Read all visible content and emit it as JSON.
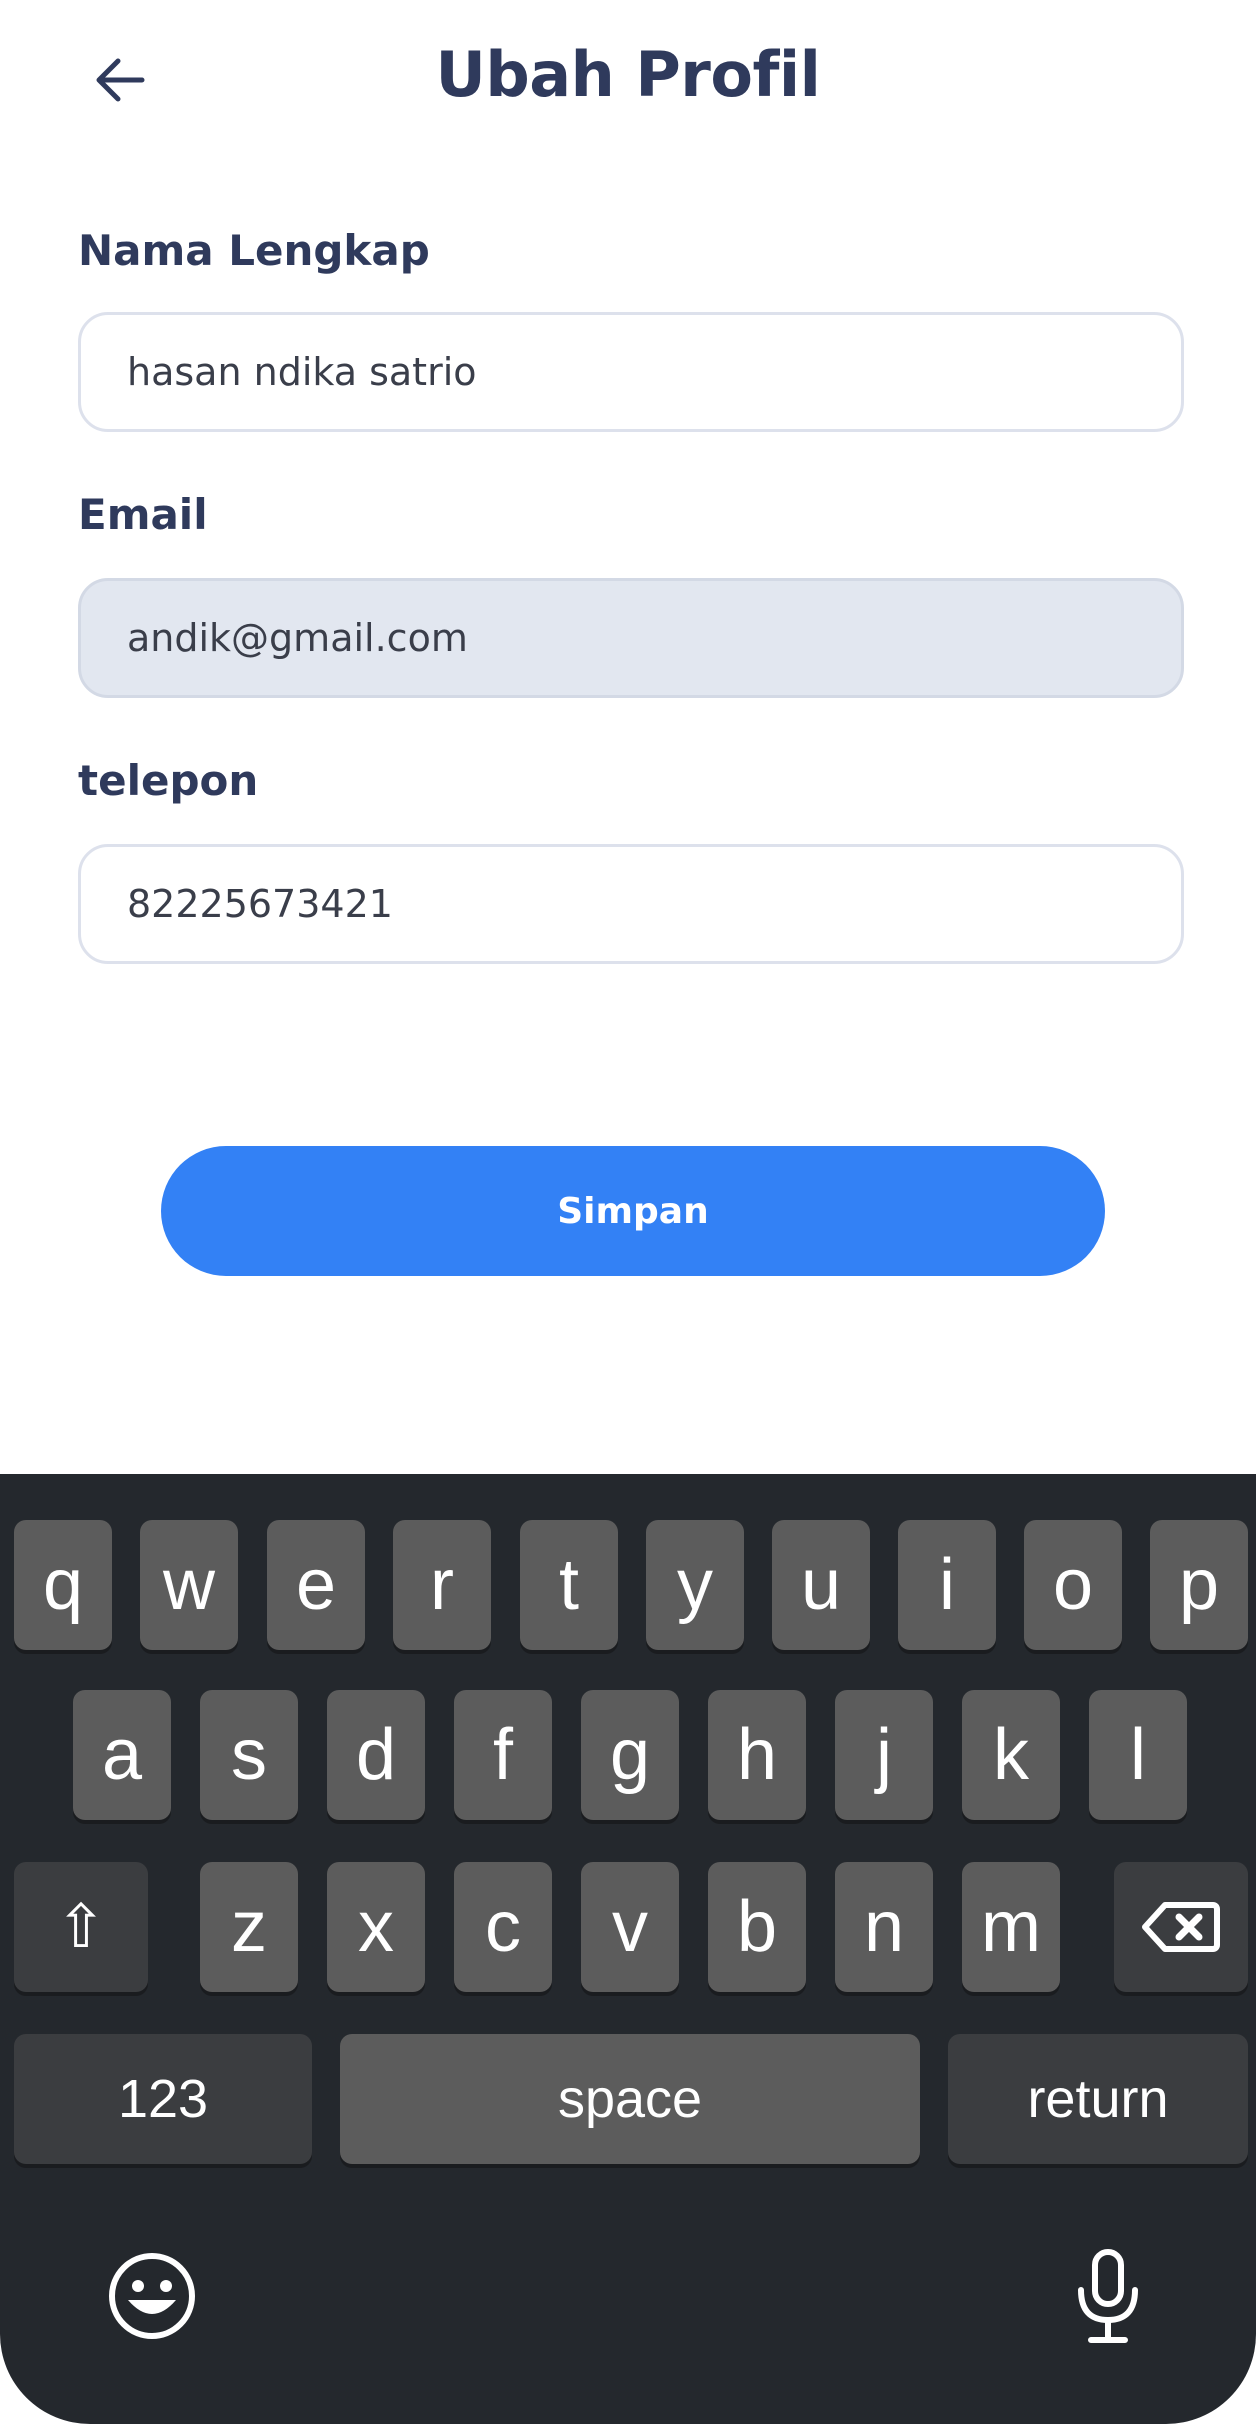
{
  "header": {
    "title": "Ubah Profil"
  },
  "form": {
    "name_label": "Nama Lengkap",
    "name_value": "hasan ndika satrio",
    "email_label": "Email",
    "email_value": "andik@gmail.com",
    "phone_label": "telepon",
    "phone_value": "82225673421",
    "save_label": "Simpan"
  },
  "keyboard": {
    "row1": [
      "q",
      "w",
      "e",
      "r",
      "t",
      "y",
      "u",
      "i",
      "o",
      "p"
    ],
    "row2": [
      "a",
      "s",
      "d",
      "f",
      "g",
      "h",
      "j",
      "k",
      "l"
    ],
    "row3": [
      "z",
      "x",
      "c",
      "v",
      "b",
      "n",
      "m"
    ],
    "shift_glyph": "⇧",
    "numbers_label": "123",
    "space_label": "space",
    "return_label": "return"
  },
  "colors": {
    "accent": "#3381f5",
    "title": "#2f3a5c",
    "keyboard_bg": "#24282d"
  }
}
